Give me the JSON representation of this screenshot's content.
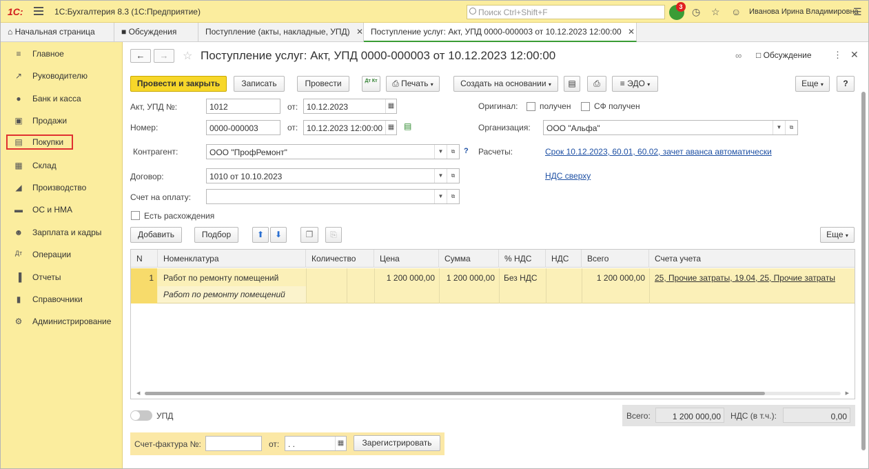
{
  "app": {
    "logo": "1С:",
    "title": "1С:Бухгалтерия 8.3  (1С:Предприятие)",
    "search_placeholder": "Поиск Ctrl+Shift+F",
    "notifications_count": "3",
    "user_name": "Иванова Ирина Владимировна"
  },
  "tabs": [
    {
      "label": "Начальная страница"
    },
    {
      "label": "Обсуждения"
    },
    {
      "label": "Поступление (акты, накладные, УПД)"
    },
    {
      "label": "Поступление услуг: Акт, УПД 0000-000003 от 10.12.2023 12:00:00"
    }
  ],
  "sidebar": {
    "items": [
      {
        "label": "Главное",
        "icon": "menu-icon"
      },
      {
        "label": "Руководителю",
        "icon": "trend-icon"
      },
      {
        "label": "Банк и касса",
        "icon": "coin-icon"
      },
      {
        "label": "Продажи",
        "icon": "bag-icon"
      },
      {
        "label": "Покупки",
        "icon": "cart-icon",
        "selected": true
      },
      {
        "label": "Склад",
        "icon": "warehouse-icon"
      },
      {
        "label": "Производство",
        "icon": "factory-icon"
      },
      {
        "label": "ОС и НМА",
        "icon": "truck-icon"
      },
      {
        "label": "Зарплата и кадры",
        "icon": "person-icon"
      },
      {
        "label": "Операции",
        "icon": "dt-kt-icon"
      },
      {
        "label": "Отчеты",
        "icon": "bar-chart-icon"
      },
      {
        "label": "Справочники",
        "icon": "book-icon"
      },
      {
        "label": "Администрирование",
        "icon": "gear-icon"
      }
    ]
  },
  "document": {
    "title": "Поступление услуг: Акт, УПД 0000-000003 от 10.12.2023 12:00:00",
    "discuss_label": "Обсуждение"
  },
  "toolbar": {
    "post_close": "Провести и закрыть",
    "save": "Записать",
    "post": "Провести",
    "dtkt": "Дт Кт",
    "print": "Печать",
    "create_based": "Создать на основании",
    "edo": "ЭДО",
    "more": "Еще",
    "help": "?"
  },
  "form": {
    "act_label": "Акт, УПД №:",
    "act_value": "1012",
    "from_label": "от:",
    "act_date": "10.12.2023",
    "number_label": "Номер:",
    "number_value": "0000-000003",
    "number_date": "10.12.2023 12:00:00",
    "original_label": "Оригинал:",
    "received_label": "получен",
    "sf_received_label": "СФ получен",
    "org_label": "Организация:",
    "org_value": "ООО \"Альфа\"",
    "contractor_label": "Контрагент:",
    "contractor_value": "ООО \"ПрофРемонт\"",
    "settlements_label": "Расчеты:",
    "settlements_link": "Срок 10.12.2023, 60.01, 60.02, зачет аванса автоматически",
    "contract_label": "Договор:",
    "contract_value": "1010 от 10.10.2023",
    "vat_link": "НДС сверху",
    "invoice_label": "Счет на оплату:",
    "invoice_value": "",
    "discrepancy_label": "Есть расхождения"
  },
  "table_toolbar": {
    "add": "Добавить",
    "select": "Подбор",
    "more": "Еще"
  },
  "table": {
    "columns": [
      "N",
      "Номенклатура",
      "Количество",
      "Цена",
      "Сумма",
      "% НДС",
      "НДС",
      "Всего",
      "Счета учета"
    ],
    "rows": [
      {
        "n": "1",
        "nomenclature": "Работ по ремонту помещений",
        "content": "Работ по ремонту помещений",
        "quantity": "",
        "price": "1 200 000,00",
        "sum": "1 200 000,00",
        "vat_rate": "Без НДС",
        "vat": "",
        "total": "1 200 000,00",
        "accounts": "25, Прочие затраты, 19.04, 25, Прочие затраты"
      }
    ]
  },
  "footer": {
    "upd_label": "УПД",
    "total_label": "Всего:",
    "total_value": "1 200 000,00",
    "vat_incl_label": "НДС (в т.ч.):",
    "vat_incl_value": "0,00",
    "sf_label": "Счет-фактура №:",
    "sf_value": "",
    "sf_from_label": "от:",
    "sf_date": " .  .",
    "register_button": "Зарегистрировать"
  }
}
